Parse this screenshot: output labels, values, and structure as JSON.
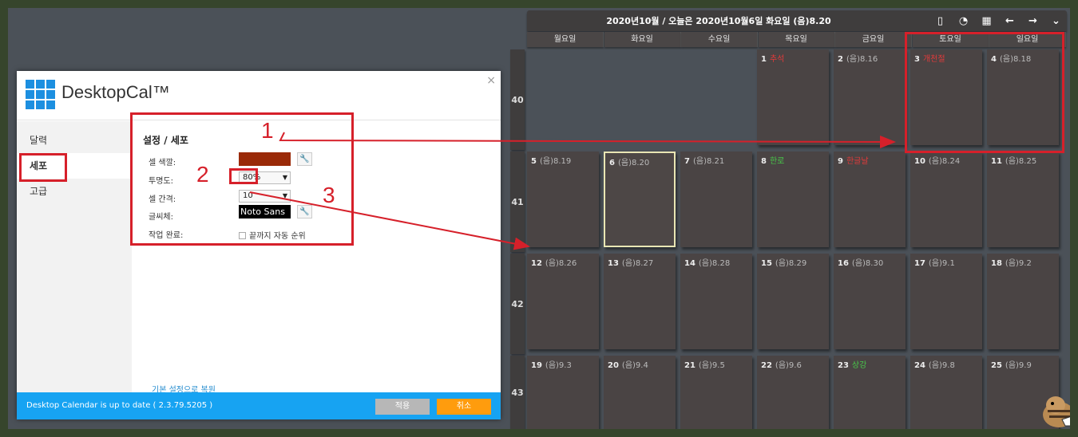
{
  "calendar": {
    "title": "2020년10월 / 오늘은 2020년10월6일 화요일 (음)8.20",
    "weekdays": [
      "월요일",
      "화요일",
      "수요일",
      "목요일",
      "금요일",
      "토요일",
      "일요일"
    ],
    "weeks": [
      "40",
      "41",
      "42",
      "43"
    ],
    "cells": [
      {
        "day": "1",
        "note": "추석",
        "color": "red"
      },
      {
        "day": "2",
        "note": "(음)8.16",
        "color": "gray"
      },
      {
        "day": "3",
        "note": "개천절",
        "color": "red"
      },
      {
        "day": "4",
        "note": "(음)8.18",
        "color": "gray"
      },
      {
        "day": "5",
        "note": "(음)8.19",
        "color": "gray"
      },
      {
        "day": "6",
        "note": "(음)8.20",
        "color": "gray"
      },
      {
        "day": "7",
        "note": "(음)8.21",
        "color": "gray"
      },
      {
        "day": "8",
        "note": "한로",
        "color": "green"
      },
      {
        "day": "9",
        "note": "한글날",
        "color": "red"
      },
      {
        "day": "10",
        "note": "(음)8.24",
        "color": "gray"
      },
      {
        "day": "11",
        "note": "(음)8.25",
        "color": "gray"
      },
      {
        "day": "12",
        "note": "(음)8.26",
        "color": "gray"
      },
      {
        "day": "13",
        "note": "(음)8.27",
        "color": "gray"
      },
      {
        "day": "14",
        "note": "(음)8.28",
        "color": "gray"
      },
      {
        "day": "15",
        "note": "(음)8.29",
        "color": "gray"
      },
      {
        "day": "16",
        "note": "(음)8.30",
        "color": "gray"
      },
      {
        "day": "17",
        "note": "(음)9.1",
        "color": "gray"
      },
      {
        "day": "18",
        "note": "(음)9.2",
        "color": "gray"
      },
      {
        "day": "19",
        "note": "(음)9.3",
        "color": "gray"
      },
      {
        "day": "20",
        "note": "(음)9.4",
        "color": "gray"
      },
      {
        "day": "21",
        "note": "(음)9.5",
        "color": "gray"
      },
      {
        "day": "22",
        "note": "(음)9.6",
        "color": "gray"
      },
      {
        "day": "23",
        "note": "상강",
        "color": "green"
      },
      {
        "day": "24",
        "note": "(음)9.8",
        "color": "gray"
      },
      {
        "day": "25",
        "note": "(음)9.9",
        "color": "gray"
      }
    ],
    "icons": [
      "phone-icon",
      "sync-icon",
      "calendar-icon",
      "arrow-left-icon",
      "arrow-right-icon",
      "chevron-down-icon"
    ]
  },
  "dialog": {
    "app_name": "DesktopCal™",
    "close_label": "×",
    "sidebar": [
      "달력",
      "세포",
      "고급"
    ],
    "section_title": "설정 / 세포",
    "labels": {
      "cell_color": "셀 색깔:",
      "opacity": "투명도:",
      "cell_gap": "셀 간격:",
      "font": "글씨체:",
      "task_done": "작업 완료:"
    },
    "values": {
      "opacity": "80%",
      "cell_gap": "10",
      "font": "Noto Sans",
      "cell_color": "#9a2a08"
    },
    "checkbox_label": "끝까지 자동 순위",
    "reset_link": "기본 설정으로 복원",
    "status_text": "Desktop Calendar is up to date ( 2.3.79.5205 )",
    "apply_button": "적용",
    "cancel_button": "취소"
  },
  "annotations": [
    "1",
    "2",
    "3"
  ]
}
